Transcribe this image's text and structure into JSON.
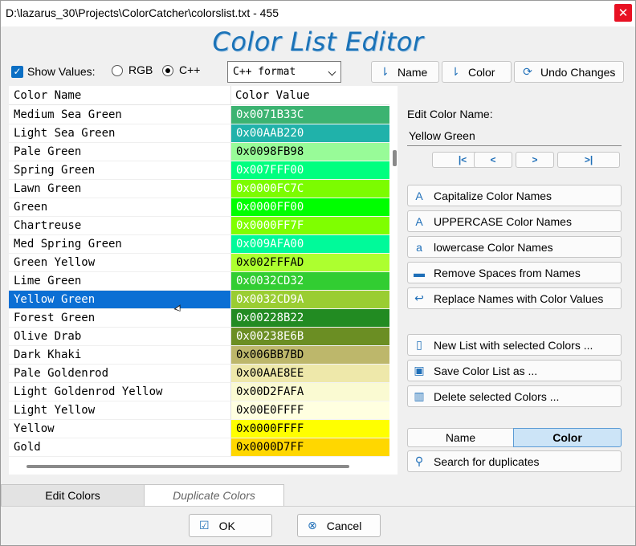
{
  "window": {
    "title": "D:\\lazarus_30\\Projects\\ColorCatcher\\colorslist.txt - 455",
    "close_glyph": "✕"
  },
  "app_title": "Color List Editor",
  "options": {
    "show_values_label": "Show Values:",
    "show_values_checked": true,
    "format_rgb_label": "RGB",
    "format_cpp_label": "C++",
    "format_selected": "C++",
    "format_combo_value": "C++ format"
  },
  "toolbar": {
    "sort_name": "Name",
    "sort_color": "Color",
    "undo": "Undo Changes"
  },
  "grid": {
    "col_name": "Color Name",
    "col_value": "Color Value",
    "selected_index": 10,
    "rows": [
      {
        "name": "Medium Sea Green",
        "value": "0x0071B33C",
        "bg": "#3CB371",
        "fg": "#ffffff"
      },
      {
        "name": "Light Sea Green",
        "value": "0x00AAB220",
        "bg": "#20B2AA",
        "fg": "#ffffff"
      },
      {
        "name": "Pale Green",
        "value": "0x0098FB98",
        "bg": "#98FB98",
        "fg": "#000000"
      },
      {
        "name": "Spring Green",
        "value": "0x007FFF00",
        "bg": "#00FF7F",
        "fg": "#ffffff"
      },
      {
        "name": "Lawn Green",
        "value": "0x0000FC7C",
        "bg": "#7CFC00",
        "fg": "#ffffff"
      },
      {
        "name": "Green",
        "value": "0x0000FF00",
        "bg": "#00FF00",
        "fg": "#ffffff"
      },
      {
        "name": "Chartreuse",
        "value": "0x0000FF7F",
        "bg": "#7FFF00",
        "fg": "#ffffff"
      },
      {
        "name": "Med Spring Green",
        "value": "0x009AFA00",
        "bg": "#00FA9A",
        "fg": "#ffffff"
      },
      {
        "name": "Green Yellow",
        "value": "0x002FFFAD",
        "bg": "#ADFF2F",
        "fg": "#000000"
      },
      {
        "name": "Lime Green",
        "value": "0x0032CD32",
        "bg": "#32CD32",
        "fg": "#ffffff"
      },
      {
        "name": "Yellow Green",
        "value": "0x0032CD9A",
        "bg": "#9ACD32",
        "fg": "#ffffff"
      },
      {
        "name": "Forest Green",
        "value": "0x00228B22",
        "bg": "#228B22",
        "fg": "#ffffff"
      },
      {
        "name": "Olive Drab",
        "value": "0x00238E6B",
        "bg": "#6B8E23",
        "fg": "#ffffff"
      },
      {
        "name": "Dark Khaki",
        "value": "0x006BB7BD",
        "bg": "#BDB76B",
        "fg": "#000000"
      },
      {
        "name": "Pale Goldenrod",
        "value": "0x00AAE8EE",
        "bg": "#EEE8AA",
        "fg": "#000000"
      },
      {
        "name": "Light Goldenrod Yellow",
        "value": "0x00D2FAFA",
        "bg": "#FAFAD2",
        "fg": "#000000"
      },
      {
        "name": "Light Yellow",
        "value": "0x00E0FFFF",
        "bg": "#FFFFE0",
        "fg": "#000000"
      },
      {
        "name": "Yellow",
        "value": "0x0000FFFF",
        "bg": "#FFFF00",
        "fg": "#000000"
      },
      {
        "name": "Gold",
        "value": "0x0000D7FF",
        "bg": "#FFD700",
        "fg": "#000000"
      }
    ]
  },
  "editor": {
    "label": "Edit Color Name:",
    "name_value": "Yellow Green",
    "nav": {
      "first": "|<",
      "prev": "<",
      "next": ">",
      "last": ">|"
    }
  },
  "actions": {
    "capitalize": "Capitalize Color Names",
    "uppercase": "UPPERCASE Color Names",
    "lowercase": "lowercase Color Names",
    "remove_spaces": "Remove Spaces from Names",
    "replace_names": "Replace Names with Color Values",
    "new_list": "New List with selected Colors ...",
    "save_list": "Save Color List as ...",
    "delete_selected": "Delete selected Colors ..."
  },
  "duplicates": {
    "toggle_name": "Name",
    "toggle_color": "Color",
    "toggle_selected": "Color",
    "search": "Search for duplicates"
  },
  "tabs": {
    "edit_colors": "Edit Colors",
    "duplicate_colors": "Duplicate Colors",
    "active": "Edit Colors"
  },
  "footer": {
    "ok": "OK",
    "cancel": "Cancel"
  },
  "icons": {
    "sort_name": "sort-desc-icon",
    "sort_color": "sort-desc-icon",
    "undo": "refresh-icon",
    "capitalize": "letter-a-icon",
    "uppercase": "letter-a-icon",
    "lowercase": "letter-a-small-icon",
    "remove_spaces": "minus-icon",
    "replace_names": "undo-arrow-icon",
    "new_list": "new-document-icon",
    "save_list": "save-icon",
    "delete_selected": "trash-icon",
    "search": "search-icon",
    "ok": "check-icon",
    "cancel": "cancel-circle-icon"
  },
  "colors": {
    "accent": "#1f6fb8",
    "title": "#1a72b7",
    "selection": "#0b6fd4",
    "close": "#e81123",
    "toggle_active": "#cce4f7"
  }
}
